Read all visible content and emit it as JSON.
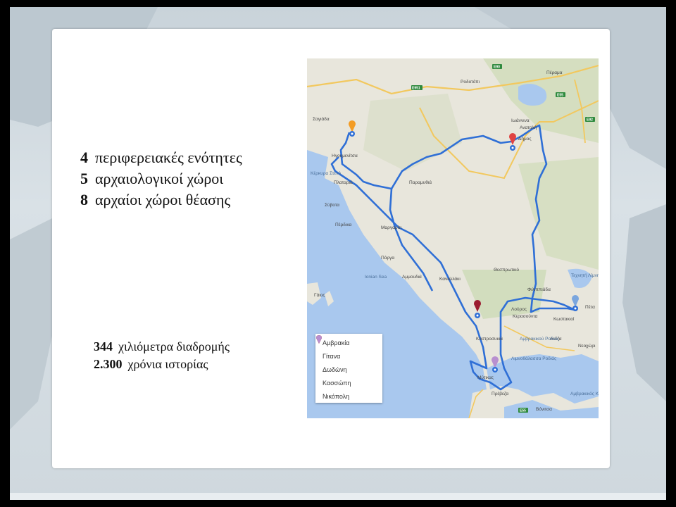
{
  "stats": [
    {
      "number": "4",
      "label": "περιφερειακές ενότητες"
    },
    {
      "number": "5",
      "label": "αρχαιολογικοί χώροι"
    },
    {
      "number": "8",
      "label": "αρχαίοι χώροι θέασης"
    }
  ],
  "route_stats": [
    {
      "number": "344",
      "label": "χιλιόμετρα διαδρομής"
    },
    {
      "number": "2.300",
      "label": "χρόνια ιστορίας"
    }
  ],
  "map": {
    "places": [
      "Ιωάννινα",
      "Ροδοτόπι",
      "Πέραμα",
      "Ανατολή",
      "Δήμος",
      "Σαγιάδα",
      "Ηγουμενίτσα",
      "Πλαταριά",
      "Σύβοτα",
      "Πέρδικα",
      "Μαργαρίτι",
      "Παραμυθιά",
      "Πάργα",
      "Αμμουδιά",
      "Καναλλάκι",
      "Θεσπρωτικό",
      "Φιλιππιάδα",
      "Λούρος",
      "Κερασούντα",
      "Κωστακιοί",
      "Πέτα",
      "Νεοχώρι",
      "Ανέζα",
      "Καστροσυκιά",
      "Μύτικας",
      "Πρέβεζα",
      "Βόνιτσα",
      "Γάιος",
      "Ionian Sea",
      "Κέρκυρα Στενό",
      "Αμβρακικός Κόλπος",
      "Τεχνητή Λίμνη",
      "Αμβρακικού Ροδιάς",
      "Λιμνοθάλασσα Ροδιάς"
    ],
    "road_shields": [
      "E90",
      "E951",
      "E55",
      "E92"
    ],
    "legend": [
      {
        "name": "Αμβρακία",
        "color": "#7aa6de"
      },
      {
        "name": "Γίτανα",
        "color": "#f39c24"
      },
      {
        "name": "Δωδώνη",
        "color": "#e04343"
      },
      {
        "name": "Κασσώπη",
        "color": "#9b1b30"
      },
      {
        "name": "Νικόπολη",
        "color": "#b88fd0"
      }
    ]
  },
  "colors": {
    "route": "#2f6fd6",
    "sea": "#a9c8ee",
    "land": "#e8e6dc",
    "road": "#f2c85e"
  }
}
